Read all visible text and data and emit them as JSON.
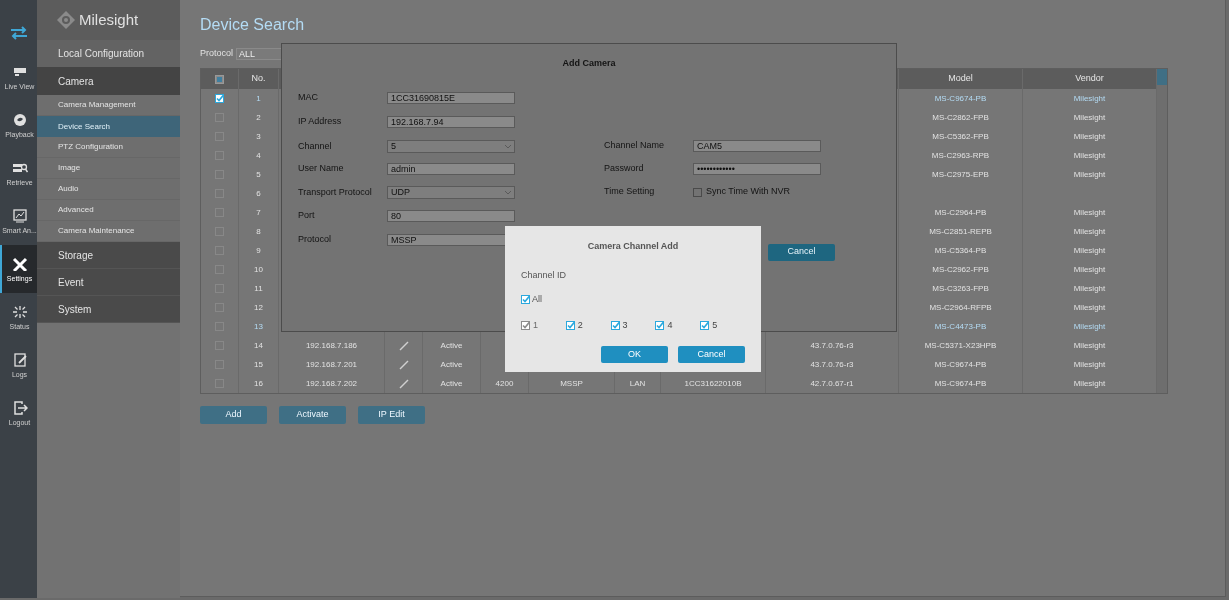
{
  "nav_rail": {
    "items": [
      {
        "label": "Live View",
        "selected": false
      },
      {
        "label": "Playback",
        "selected": false
      },
      {
        "label": "Retrieve",
        "selected": false
      },
      {
        "label": "Smart An...",
        "selected": false
      },
      {
        "label": "Settings",
        "selected": true
      },
      {
        "label": "Status",
        "selected": false
      },
      {
        "label": "Logs",
        "selected": false
      },
      {
        "label": "Logout",
        "selected": false
      }
    ]
  },
  "logo": {
    "text": "Milesight"
  },
  "menu": {
    "sections": [
      {
        "label": "Local Configuration",
        "expanded": false
      },
      {
        "label": "Camera",
        "expanded": true,
        "children": [
          {
            "label": "Camera Management",
            "selected": false
          },
          {
            "label": "Device Search",
            "selected": true
          },
          {
            "label": "PTZ Configuration",
            "selected": false
          },
          {
            "label": "Image",
            "selected": false
          },
          {
            "label": "Audio",
            "selected": false
          },
          {
            "label": "Advanced",
            "selected": false
          },
          {
            "label": "Camera Maintenance",
            "selected": false
          }
        ]
      },
      {
        "label": "Storage",
        "expanded": false
      },
      {
        "label": "Event",
        "expanded": false
      },
      {
        "label": "System",
        "expanded": false
      }
    ]
  },
  "page_title": "Device Search",
  "protocol_filter": {
    "label": "Protocol",
    "value": "ALL"
  },
  "table": {
    "header": {
      "select_all_indeterminate": true,
      "no": "No.",
      "model": "Model",
      "vendor": "Vendor"
    },
    "rows": [
      {
        "checked": true,
        "highlighted": true,
        "no": "1",
        "model": "MS-C9674-PB",
        "vendor": "Milesight"
      },
      {
        "checked": false,
        "highlighted": false,
        "no": "2",
        "model": "MS-C2862-FPB",
        "vendor": "Milesight"
      },
      {
        "checked": false,
        "highlighted": false,
        "no": "3",
        "model": "MS-C5362-FPB",
        "vendor": "Milesight"
      },
      {
        "checked": false,
        "highlighted": false,
        "no": "4",
        "model": "MS-C2963-RPB",
        "vendor": "Milesight"
      },
      {
        "checked": false,
        "highlighted": false,
        "no": "5",
        "model": "MS-C2975-EPB",
        "vendor": "Milesight"
      },
      {
        "checked": false,
        "highlighted": false,
        "no": "6"
      },
      {
        "checked": false,
        "highlighted": false,
        "no": "7",
        "model": "MS-C2964-PB",
        "vendor": "Milesight"
      },
      {
        "checked": false,
        "highlighted": false,
        "no": "8",
        "model": "MS-C2851-REPB",
        "vendor": "Milesight"
      },
      {
        "checked": false,
        "highlighted": false,
        "no": "9",
        "model": "MS-C5364-PB",
        "vendor": "Milesight"
      },
      {
        "checked": false,
        "highlighted": false,
        "no": "10",
        "model": "MS-C2962-FPB",
        "vendor": "Milesight"
      },
      {
        "checked": false,
        "highlighted": false,
        "no": "11",
        "model": "MS-C3263-FPB",
        "vendor": "Milesight"
      },
      {
        "checked": false,
        "highlighted": false,
        "no": "12",
        "model": "MS-C2964-RFPB",
        "vendor": "Milesight"
      },
      {
        "checked": false,
        "highlighted": true,
        "no": "13",
        "model": "MS-C4473-PB",
        "vendor": "Milesight"
      },
      {
        "checked": false,
        "highlighted": false,
        "no": "14",
        "ip": "192.168.7.186",
        "editable": true,
        "status": "Active",
        "firmware": "43.7.0.76-r3",
        "model": "MS-C5371-X23HPB",
        "vendor": "Milesight"
      },
      {
        "checked": false,
        "highlighted": false,
        "no": "15",
        "ip": "192.168.7.201",
        "editable": true,
        "status": "Active",
        "firmware": "43.7.0.76-r3",
        "model": "MS-C9674-PB",
        "vendor": "Milesight"
      },
      {
        "checked": false,
        "highlighted": false,
        "no": "16",
        "ip": "192.168.7.202",
        "editable": true,
        "status": "Active",
        "port": "4200",
        "protocol": "MSSP",
        "network": "LAN",
        "mac": "1CC31622010B",
        "firmware": "42.7.0.67-r1",
        "model": "MS-C9674-PB",
        "vendor": "Milesight"
      }
    ]
  },
  "actions": [
    "Add",
    "Activate",
    "IP Edit"
  ],
  "add_camera_dialog": {
    "title": "Add Camera",
    "left_fields": [
      {
        "label": "MAC",
        "value": "1CC31690815E",
        "kind": "text"
      },
      {
        "label": "IP Address",
        "value": "192.168.7.94",
        "kind": "text"
      },
      {
        "label": "Channel",
        "value": "5",
        "kind": "select"
      },
      {
        "label": "User Name",
        "value": "admin",
        "kind": "text"
      },
      {
        "label": "Transport Protocol",
        "value": "UDP",
        "kind": "select"
      },
      {
        "label": "Port",
        "value": "80",
        "kind": "text"
      },
      {
        "label": "Protocol",
        "value": "MSSP",
        "kind": "text"
      }
    ],
    "right_fields": [
      {
        "label": "Channel Name",
        "value": "CAM5",
        "kind": "text"
      },
      {
        "label": "Password",
        "value": "••••••••••••",
        "kind": "text"
      },
      {
        "label": "Time Setting",
        "value": "Sync Time With NVR",
        "kind": "checkbox",
        "checked": false
      }
    ],
    "cancel": "Cancel"
  },
  "channel_dialog": {
    "title": "Camera Channel Add",
    "label": "Channel ID",
    "all": {
      "label": "All",
      "checked": true
    },
    "channels": [
      {
        "label": "1",
        "checked": true,
        "disabled": true
      },
      {
        "label": "2",
        "checked": true,
        "disabled": false
      },
      {
        "label": "3",
        "checked": true,
        "disabled": false
      },
      {
        "label": "4",
        "checked": true,
        "disabled": false
      },
      {
        "label": "5",
        "checked": true,
        "disabled": false
      }
    ],
    "ok": "OK",
    "cancel": "Cancel"
  }
}
